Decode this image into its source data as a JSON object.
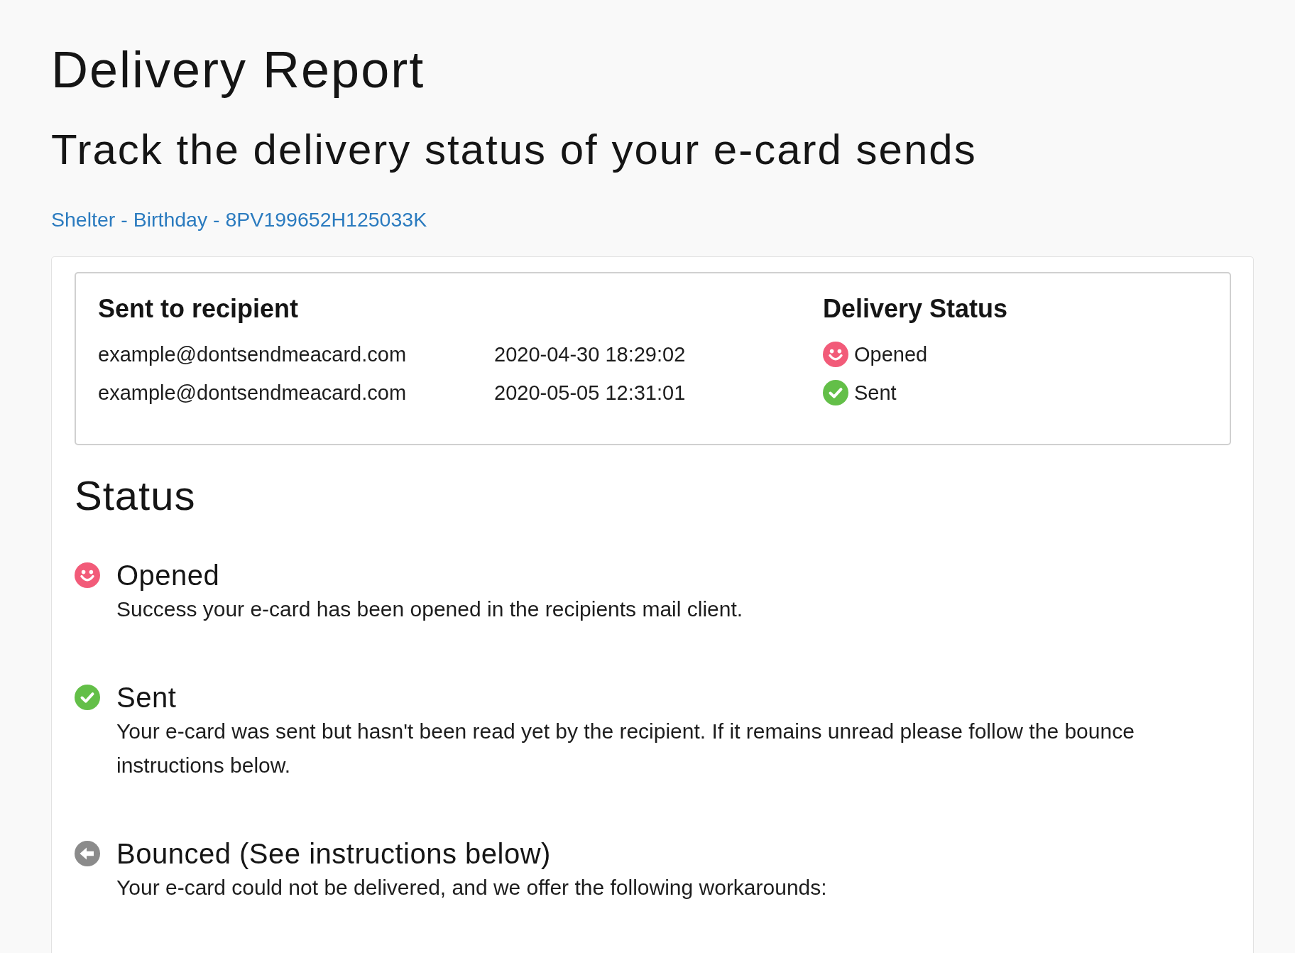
{
  "header": {
    "title": "Delivery Report",
    "subtitle": "Track the delivery status of your e-card sends",
    "link": "Shelter - Birthday - 8PV199652H125033K"
  },
  "deliveries": {
    "columns": [
      "Sent to recipient",
      "Delivery Status"
    ],
    "rows": [
      {
        "recipient": "example@dontsendmeacard.com",
        "time": "2020-04-30 18:29:02",
        "status": {
          "kind": "opened",
          "label": "Opened"
        }
      },
      {
        "recipient": "example@dontsendmeacard.com",
        "time": "2020-05-05 12:31:01",
        "status": {
          "kind": "sent",
          "label": "Sent"
        }
      }
    ]
  },
  "status_legend": {
    "title": "Status",
    "items": [
      {
        "kind": "opened",
        "title": "Opened",
        "description": "Success your e-card has been opened in the recipients mail client."
      },
      {
        "kind": "sent",
        "title": "Sent",
        "description": "Your e-card was sent but hasn't been read yet by the recipient. If it remains unread please follow the bounce instructions below."
      },
      {
        "kind": "bounced",
        "title": "Bounced (See instructions below)",
        "description": "Your e-card could not be delivered, and we offer the following workarounds:"
      }
    ]
  }
}
